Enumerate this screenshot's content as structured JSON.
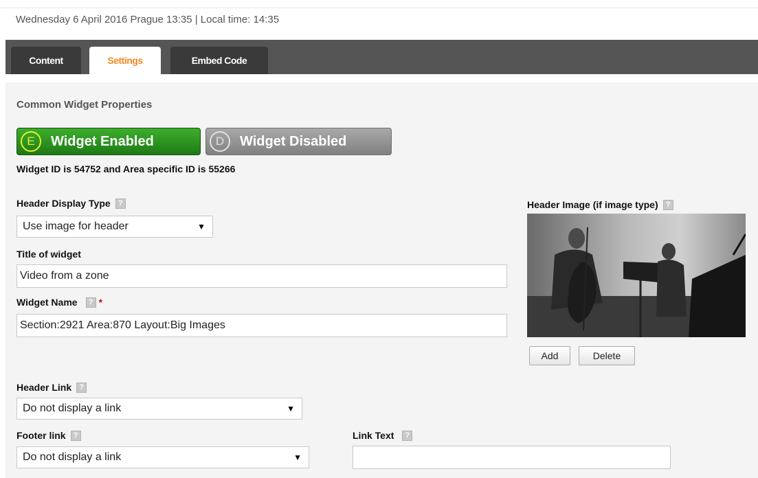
{
  "datetime_line": "Wednesday 6 April 2016 Prague 13:35 | Local time: 14:35",
  "tabs": [
    {
      "label": "Content",
      "active": false
    },
    {
      "label": "Settings",
      "active": true
    },
    {
      "label": "Embed Code",
      "active": false
    }
  ],
  "section_title": "Common Widget Properties",
  "toggles": {
    "enabled": {
      "letter": "E",
      "label": "Widget Enabled"
    },
    "disabled": {
      "letter": "D",
      "label": "Widget Disabled"
    }
  },
  "widget_id_line": "Widget ID is 54752 and Area specific ID is 55266",
  "fields": {
    "header_display_type": {
      "label": "Header Display Type",
      "value": "Use image for header"
    },
    "title_of_widget": {
      "label": "Title of widget",
      "value": "Video from a zone"
    },
    "widget_name": {
      "label": "Widget Name",
      "required_mark": "*",
      "value": "Section:2921 Area:870 Layout:Big Images"
    },
    "header_link": {
      "label": "Header Link",
      "value": "Do not display a link"
    },
    "footer_link": {
      "label": "Footer link",
      "value": "Do not display a link"
    },
    "link_text": {
      "label": "Link Text",
      "value": ""
    }
  },
  "header_image": {
    "label": "Header Image (if image type)",
    "add_label": "Add",
    "delete_label": "Delete"
  },
  "help_glyph": "?",
  "dropdown_glyph": "▼",
  "colors": {
    "tab_bar": "#555555",
    "active_tab_text": "#f08a24",
    "enabled_green": "#2e9a22",
    "disabled_gray": "#8f8f8f",
    "required": "#d0021b"
  }
}
